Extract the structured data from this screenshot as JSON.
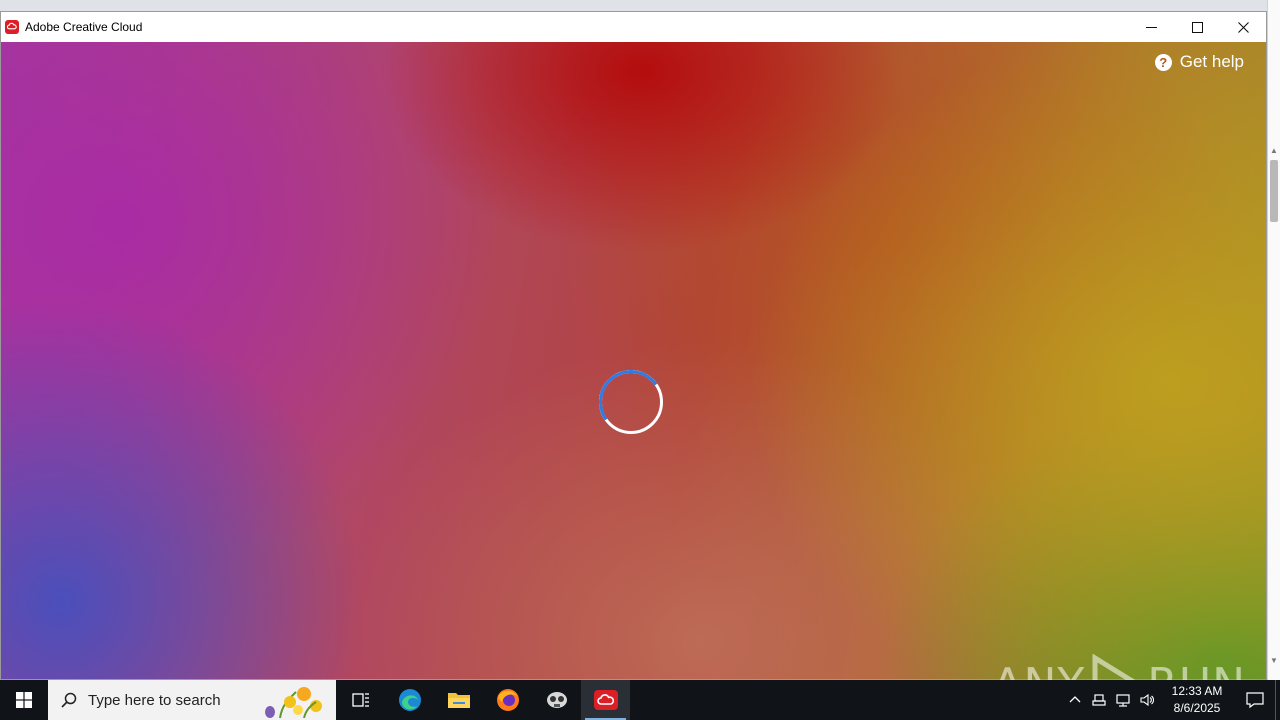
{
  "window": {
    "title": "Adobe Creative Cloud",
    "app_icon": "creative-cloud-icon",
    "controls": [
      "minimize-icon",
      "maximize-icon",
      "close-icon"
    ]
  },
  "content": {
    "help_label": "Get help",
    "help_icon": "question-icon",
    "loading": true,
    "spinner_color": "#2d7be8"
  },
  "watermark": {
    "text_left": "ANY",
    "text_right": "RUN"
  },
  "taskbar": {
    "search_placeholder": "Type here to search",
    "apps": [
      "task-view-icon",
      "edge-icon",
      "file-explorer-icon",
      "firefox-icon",
      "anyrun-agent-icon",
      "creative-cloud-icon"
    ],
    "active_app": "creative-cloud-icon",
    "clock_time": "12:33 AM",
    "clock_date": "8/6/2025",
    "tray": [
      "chevron-up-icon",
      "usb-icon",
      "network-icon",
      "volume-icon"
    ]
  }
}
